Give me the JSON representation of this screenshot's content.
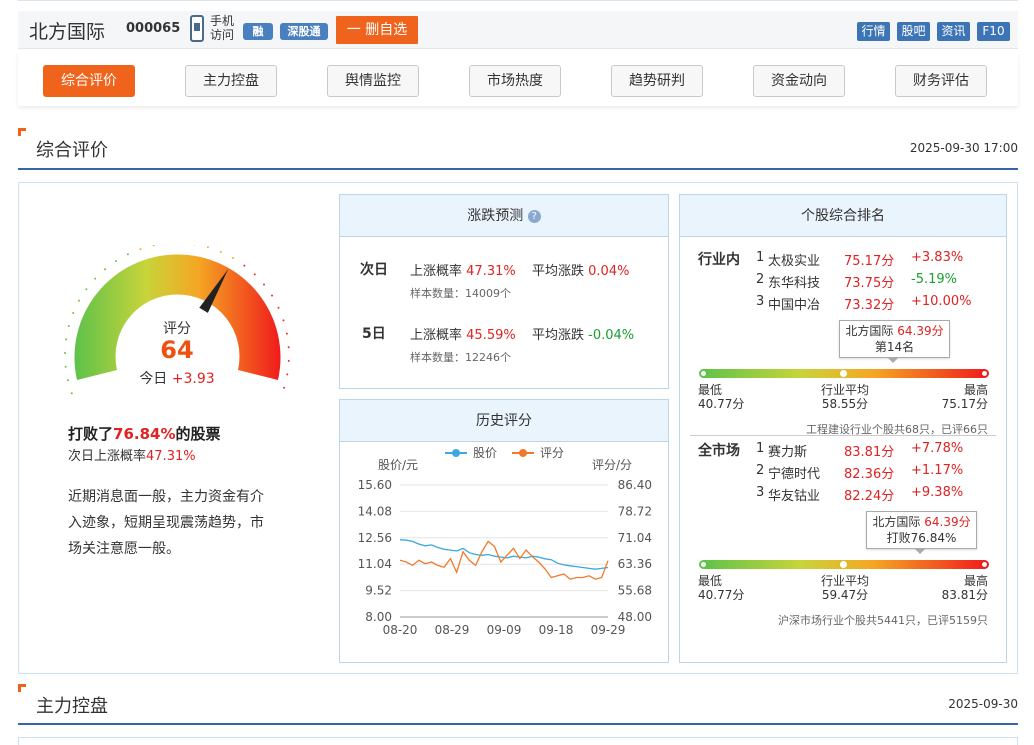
{
  "header": {
    "stock_name": "北方国际",
    "stock_code": "000065",
    "phone_label": "手机\n访问",
    "badge_rong": "融",
    "badge_shengutong": "深股通",
    "delete_fav": "一 删自选",
    "top_links": [
      "行情",
      "股吧",
      "资讯",
      "F10"
    ]
  },
  "nav": {
    "tabs": [
      "综合评价",
      "主力控盘",
      "舆情监控",
      "市场热度",
      "趋势研判",
      "资金动向",
      "财务评估"
    ],
    "active_index": 0
  },
  "section1": {
    "title": "综合评价",
    "date": "2025-09-30 17:00"
  },
  "gauge": {
    "label": "评分",
    "score": "64",
    "score_value": 64,
    "today_label": "今日",
    "today_change": "+3.93"
  },
  "summary": {
    "beat_prefix": "打败了",
    "beat_pct": "76.84%",
    "beat_suffix": "的股票",
    "next_up_label": "次日上涨概率",
    "next_up_pct": "47.31%",
    "comment": "近期消息面一般，主力资金有介入迹象，短期呈现震荡趋势，市场关注意愿一般。"
  },
  "forecast": {
    "title": "涨跌预测",
    "help_icon": "question-icon",
    "rows": [
      {
        "period": "次日",
        "up_label": "上涨概率",
        "up_value": "47.31%",
        "avg_label": "平均涨跌",
        "avg_value": "0.04%",
        "avg_color": "red",
        "sample_label": "样本数量：",
        "sample_value": "14009个"
      },
      {
        "period": "5日",
        "up_label": "上涨概率",
        "up_value": "45.59%",
        "avg_label": "平均涨跌",
        "avg_value": "-0.04%",
        "avg_color": "green",
        "sample_label": "样本数量：",
        "sample_value": "12246个"
      }
    ]
  },
  "history": {
    "title": "历史评分",
    "legend_price": "股价",
    "legend_score": "评分",
    "left_unit": "股价/元",
    "right_unit": "评分/分",
    "colors": {
      "price": "#3ba8e0",
      "score": "#f07a2a"
    }
  },
  "chart_data": {
    "type": "line",
    "x_ticks": [
      "08-20",
      "08-29",
      "09-09",
      "09-18",
      "09-29"
    ],
    "y_left_ticks": [
      "15.60",
      "14.08",
      "12.56",
      "11.04",
      "9.52",
      "8.00"
    ],
    "y_right_ticks": [
      "86.40",
      "78.72",
      "71.04",
      "63.36",
      "55.68",
      "48.00"
    ],
    "ylim_left": [
      8.0,
      15.6
    ],
    "ylim_right": [
      48.0,
      86.4
    ],
    "series": [
      {
        "name": "股价",
        "axis": "left",
        "values": [
          12.45,
          12.42,
          12.35,
          12.2,
          12.1,
          12.15,
          12.0,
          11.9,
          11.85,
          11.8,
          11.95,
          11.7,
          11.6,
          11.55,
          11.6,
          11.5,
          11.45,
          11.4,
          11.5,
          11.45,
          11.4,
          11.5,
          11.45,
          11.35,
          11.3,
          11.1,
          11.0,
          10.95,
          10.9,
          10.85,
          10.8,
          10.75,
          10.8,
          10.85
        ]
      },
      {
        "name": "评分",
        "axis": "right",
        "values": [
          64.5,
          64.0,
          63.0,
          64.5,
          63.5,
          64.0,
          63.0,
          62.5,
          65.0,
          61.0,
          67.0,
          64.5,
          63.0,
          67.0,
          70.0,
          68.5,
          64.0,
          66.0,
          68.0,
          65.0,
          67.5,
          65.5,
          64.0,
          62.0,
          59.5,
          60.0,
          60.5,
          59.0,
          59.5,
          59.5,
          60.0,
          59.0,
          59.5,
          64.39
        ]
      }
    ]
  },
  "ranking": {
    "title": "个股综合排名",
    "industry": {
      "label": "行业内",
      "items": [
        {
          "rank": "1",
          "name": "太极实业",
          "score": "75.17分",
          "change": "+3.83%",
          "color": "red"
        },
        {
          "rank": "2",
          "name": "东华科技",
          "score": "73.75分",
          "change": "-5.19%",
          "color": "green"
        },
        {
          "rank": "3",
          "name": "中国中冶",
          "score": "73.32分",
          "change": "+10.00%",
          "color": "red"
        }
      ],
      "tip_name": "北方国际",
      "tip_score": "64.39分",
      "tip_sub": "第14名",
      "position": 0.33,
      "low_label": "最低",
      "low_value": "40.77分",
      "avg_label": "行业平均",
      "avg_value": "58.55分",
      "high_label": "最高",
      "high_value": "75.17分",
      "footer": "工程建设行业个股共68只，已评66只"
    },
    "market": {
      "label": "全市场",
      "items": [
        {
          "rank": "1",
          "name": "赛力斯",
          "score": "83.81分",
          "change": "+7.78%",
          "color": "red"
        },
        {
          "rank": "2",
          "name": "宁德时代",
          "score": "82.36分",
          "change": "+1.17%",
          "color": "red"
        },
        {
          "rank": "3",
          "name": "华友钴业",
          "score": "82.24分",
          "change": "+9.38%",
          "color": "red"
        }
      ],
      "tip_name": "北方国际",
      "tip_score": "64.39分",
      "tip_sub": "打败76.84%",
      "position": 0.55,
      "low_label": "最低",
      "low_value": "40.77分",
      "avg_label": "行业平均",
      "avg_value": "59.47分",
      "high_label": "最高",
      "high_value": "83.81分",
      "footer": "沪深市场行业个股共5441只，已评5159只"
    }
  },
  "section2": {
    "title": "主力控盘",
    "date": "2025-09-30"
  }
}
